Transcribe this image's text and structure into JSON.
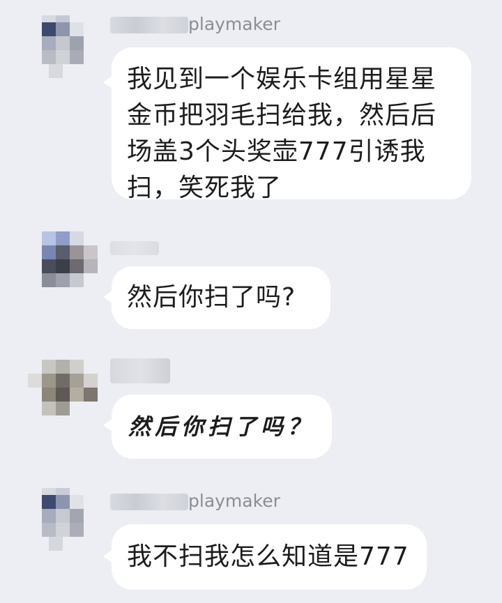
{
  "messages": [
    {
      "sender_suffix": "playmaker",
      "text": "我见到一个娱乐卡组用星星金币把羽毛扫给我，然后后场盖3个头奖壶777引诱我扫，笑死我了",
      "lines": [
        "我见到一个娱乐卡组用星星",
        "金币把羽毛扫给我，然后后",
        "场盖3个头奖壶777引诱我",
        "扫，笑死我了"
      ]
    },
    {
      "sender_suffix": "",
      "text": "然后你扫了吗?"
    },
    {
      "sender_suffix": "",
      "text": "然后你扫了吗？"
    },
    {
      "sender_suffix": "playmaker",
      "text": "我不扫我怎么知道是777"
    }
  ],
  "colors": {
    "background": "#eceef3",
    "bubble": "#ffffff",
    "name_text": "#8a8d94"
  }
}
